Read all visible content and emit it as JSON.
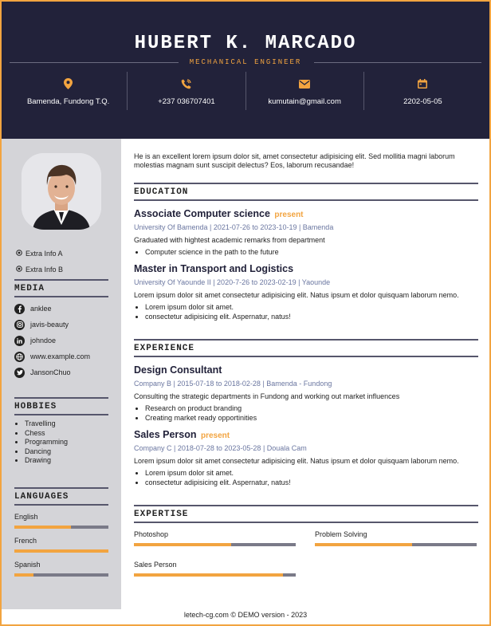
{
  "header": {
    "name": "HUBERT K. MARCADO",
    "title": "MECHANICAL ENGINEER",
    "contacts": [
      {
        "icon": "location-pin-icon",
        "value": "Bamenda, Fundong T.Q."
      },
      {
        "icon": "phone-icon",
        "value": "+237 036707401"
      },
      {
        "icon": "envelope-icon",
        "value": "kumutain@gmail.com"
      },
      {
        "icon": "calendar-icon",
        "value": "2202-05-05"
      }
    ]
  },
  "sidebar": {
    "extras": [
      "Extra Info A",
      "Extra Info B"
    ],
    "media": {
      "title": "MEDIA",
      "items": [
        {
          "icon": "facebook-icon",
          "label": "anklee"
        },
        {
          "icon": "instagram-icon",
          "label": "javis-beauty"
        },
        {
          "icon": "linkedin-icon",
          "label": "johndoe"
        },
        {
          "icon": "globe-icon",
          "label": "www.example.com"
        },
        {
          "icon": "twitter-icon",
          "label": "JansonChuo"
        }
      ]
    },
    "hobbies": {
      "title": "HOBBIES",
      "items": [
        "Travelling",
        "Chess",
        "Programming",
        "Dancing",
        "Drawing"
      ]
    },
    "languages": {
      "title": "LANGUAGES",
      "items": [
        {
          "name": "English",
          "level": 0.6
        },
        {
          "name": "French",
          "level": 1.0
        },
        {
          "name": "Spanish",
          "level": 0.2
        }
      ]
    }
  },
  "main": {
    "summary": "He is an excellent lorem ipsum dolor sit, amet consectetur adipisicing elit. Sed mollitia magni laborum molestias magnam sunt suscipit delectus? Eos, laborum recusandae!",
    "education": {
      "title": "EDUCATION",
      "entries": [
        {
          "title": "Associate Computer science",
          "present": "present",
          "sub": "University Of Bamenda | 2021-07-26 to 2023-10-19 | Bamenda",
          "desc": "Graduated with hightest academic remarks from department",
          "bullets": [
            "Computer science in the path to the future"
          ]
        },
        {
          "title": "Master in Transport and Logistics",
          "present": "",
          "sub": "University Of Yaounde II | 2020-7-26 to 2023-02-19 | Yaounde",
          "desc": "Lorem ipsum dolor sit amet consectetur adipisicing elit. Natus ipsum et dolor quisquam laborum nemo.",
          "bullets": [
            "Lorem ipsum dolor sit amet.",
            "consectetur adipisicing elit. Aspernatur, natus!"
          ]
        }
      ]
    },
    "experience": {
      "title": "EXPERIENCE",
      "entries": [
        {
          "title": "Design Consultant",
          "present": "",
          "sub": "Company B | 2015-07-18 to 2018-02-28 | Bamenda - Fundong",
          "desc": "Consulting the strategic departments in Fundong and working out market influences",
          "bullets": [
            "Research on product branding",
            "Creating market ready opportinities"
          ]
        },
        {
          "title": "Sales Person",
          "present": "present",
          "sub": "Company C | 2018-07-28 to 2023-05-28 | Douala Cam",
          "desc": "Lorem ipsum dolor sit amet consectetur adipisicing elit. Natus ipsum et dolor quisquam laborum nemo.",
          "bullets": [
            "Lorem ipsum dolor sit amet.",
            "consectetur adipisicing elit. Aspernatur, natus!"
          ]
        }
      ]
    },
    "expertise": {
      "title": "EXPERTISE",
      "items": [
        {
          "name": "Photoshop",
          "level": 0.6
        },
        {
          "name": "Problem Solving",
          "level": 0.6
        },
        {
          "name": "Sales Person",
          "level": 0.92
        }
      ]
    }
  },
  "footer": "letech-cg.com © DEMO version - 2023",
  "colors": {
    "accent": "#f2a440",
    "navy": "#22223a",
    "sidebar": "#d4d4d8",
    "bar_track": "#7a7a88"
  }
}
